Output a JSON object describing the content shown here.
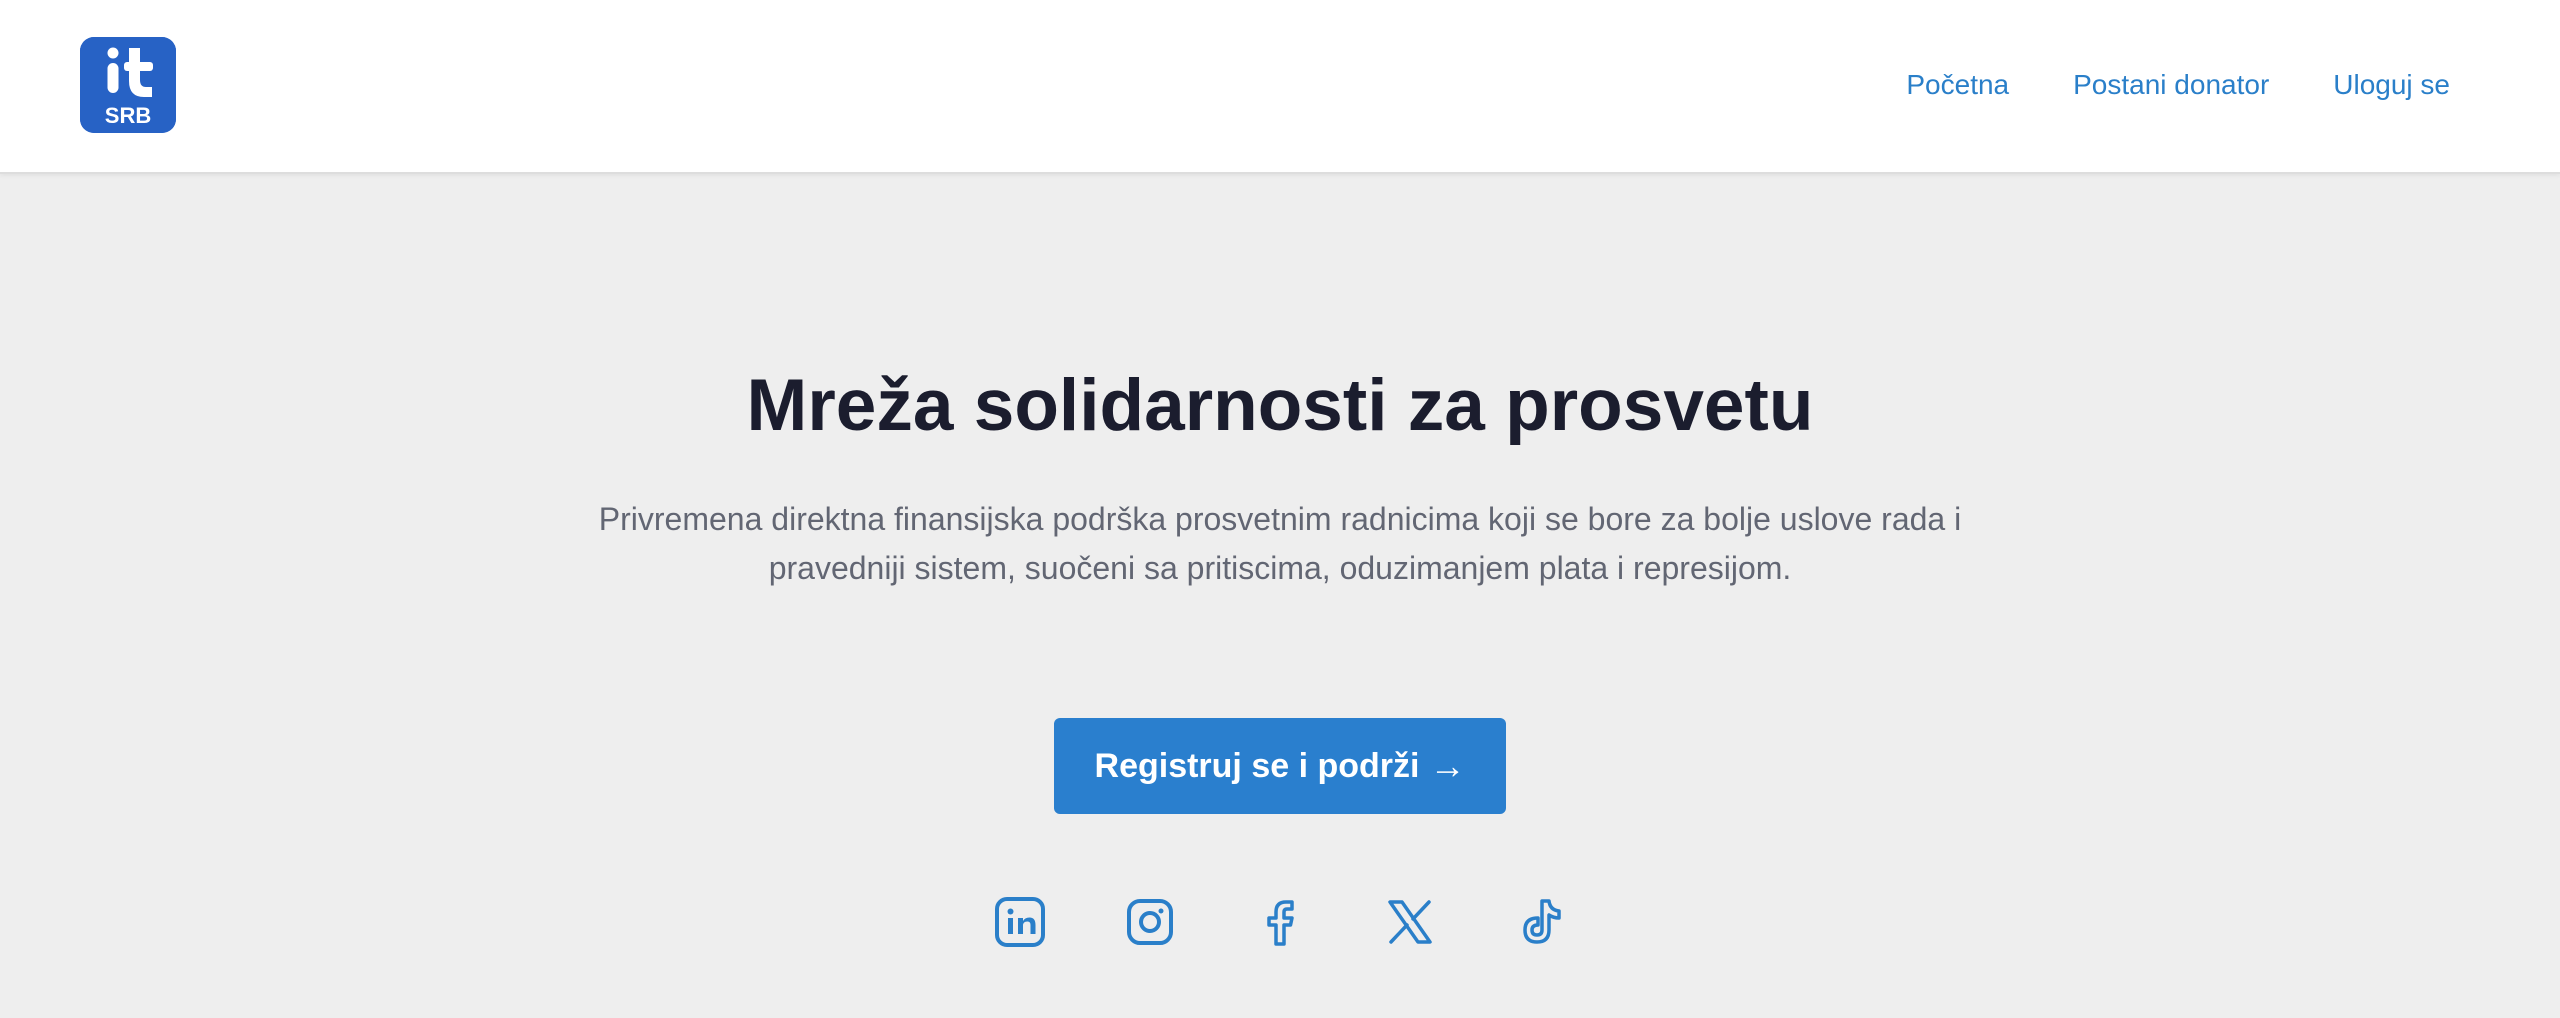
{
  "brand": {
    "logo_top": "it",
    "logo_bottom": "SRB",
    "color": "#2762c5"
  },
  "nav": {
    "items": [
      {
        "label": "Početna"
      },
      {
        "label": "Postani donator"
      },
      {
        "label": "Uloguj se"
      }
    ],
    "color": "#2a7fc9"
  },
  "hero": {
    "title": "Mreža solidarnosti za prosvetu",
    "description": "Privremena direktna finansijska podrška prosvetnim radnicima koji se bore za bolje uslove rada i pravedniji sistem, suočeni sa pritiscima, oduzimanjem plata i represijom.",
    "cta_label": "Registruj se i podrži",
    "cta_arrow": "→",
    "cta_color": "#2a7fce"
  },
  "social": {
    "icons": [
      "linkedin-icon",
      "instagram-icon",
      "facebook-icon",
      "x-icon",
      "tiktok-icon"
    ],
    "color": "#2a7fc9"
  },
  "colors": {
    "background": "#eeeeee",
    "header": "#ffffff",
    "title": "#1b1d2e",
    "text": "#626673"
  }
}
